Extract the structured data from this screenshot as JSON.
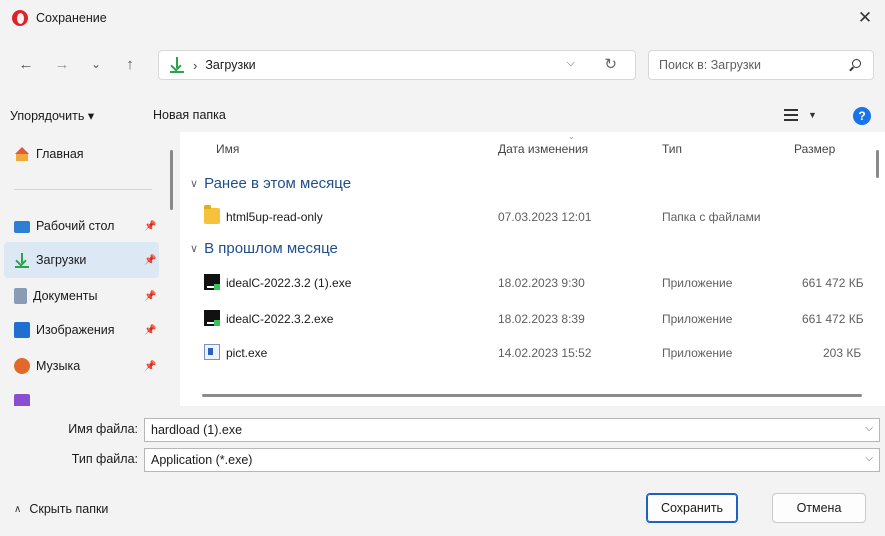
{
  "window": {
    "title": "Сохранение",
    "close_icon": "close-icon",
    "app_icon": "opera-logo"
  },
  "nav": {
    "back_icon": "←",
    "forward_icon": "→",
    "recent_icon": "⌄",
    "up_icon": "↑",
    "address": {
      "location": "Загрузки",
      "separator": "›"
    },
    "search_placeholder": "Поиск в: Загрузки"
  },
  "toolbar": {
    "organize_label": "Упорядочить ▾",
    "new_folder_label": "Новая папка",
    "help_label": "?"
  },
  "sidebar": {
    "items": [
      {
        "label": "Главная",
        "icon": "home-icon"
      },
      {
        "label": "Рабочий стол",
        "icon": "desktop-icon"
      },
      {
        "label": "Загрузки",
        "icon": "downloads-icon"
      },
      {
        "label": "Документы",
        "icon": "documents-icon"
      },
      {
        "label": "Изображения",
        "icon": "pictures-icon"
      },
      {
        "label": "Музыка",
        "icon": "music-icon"
      }
    ]
  },
  "columns": {
    "name": "Имя",
    "modified": "Дата изменения",
    "type": "Тип",
    "size": "Размер"
  },
  "groups": [
    {
      "title": "Ранее в этом месяце"
    },
    {
      "title": "В прошлом месяце"
    }
  ],
  "files": [
    {
      "name": "html5up-read-only",
      "modified": "07.03.2023 12:01",
      "type": "Папка с файлами",
      "size": "",
      "icon": "folder-icon"
    },
    {
      "name": "idealC-2022.3.2 (1).exe",
      "modified": "18.02.2023 9:30",
      "type": "Приложение",
      "size": "661 472 КБ",
      "icon": "intellij-icon"
    },
    {
      "name": "idealC-2022.3.2.exe",
      "modified": "18.02.2023 8:39",
      "type": "Приложение",
      "size": "661 472 КБ",
      "icon": "intellij-icon"
    },
    {
      "name": "pict.exe",
      "modified": "14.02.2023 15:52",
      "type": "Приложение",
      "size": "203 КБ",
      "icon": "app-icon"
    }
  ],
  "fields": {
    "filename_label": "Имя файла:",
    "filename_value": "hardload (1).exe",
    "filetype_label": "Тип файла:",
    "filetype_value": "Application (*.exe)"
  },
  "footer": {
    "hide_folders_label": "Скрыть папки",
    "save_label": "Сохранить",
    "cancel_label": "Отмена"
  },
  "colors": {
    "accent": "#1a62c4",
    "selected": "#dde8f5",
    "group_heading": "#1f4e8c",
    "downloads_green": "#2ba34d"
  }
}
